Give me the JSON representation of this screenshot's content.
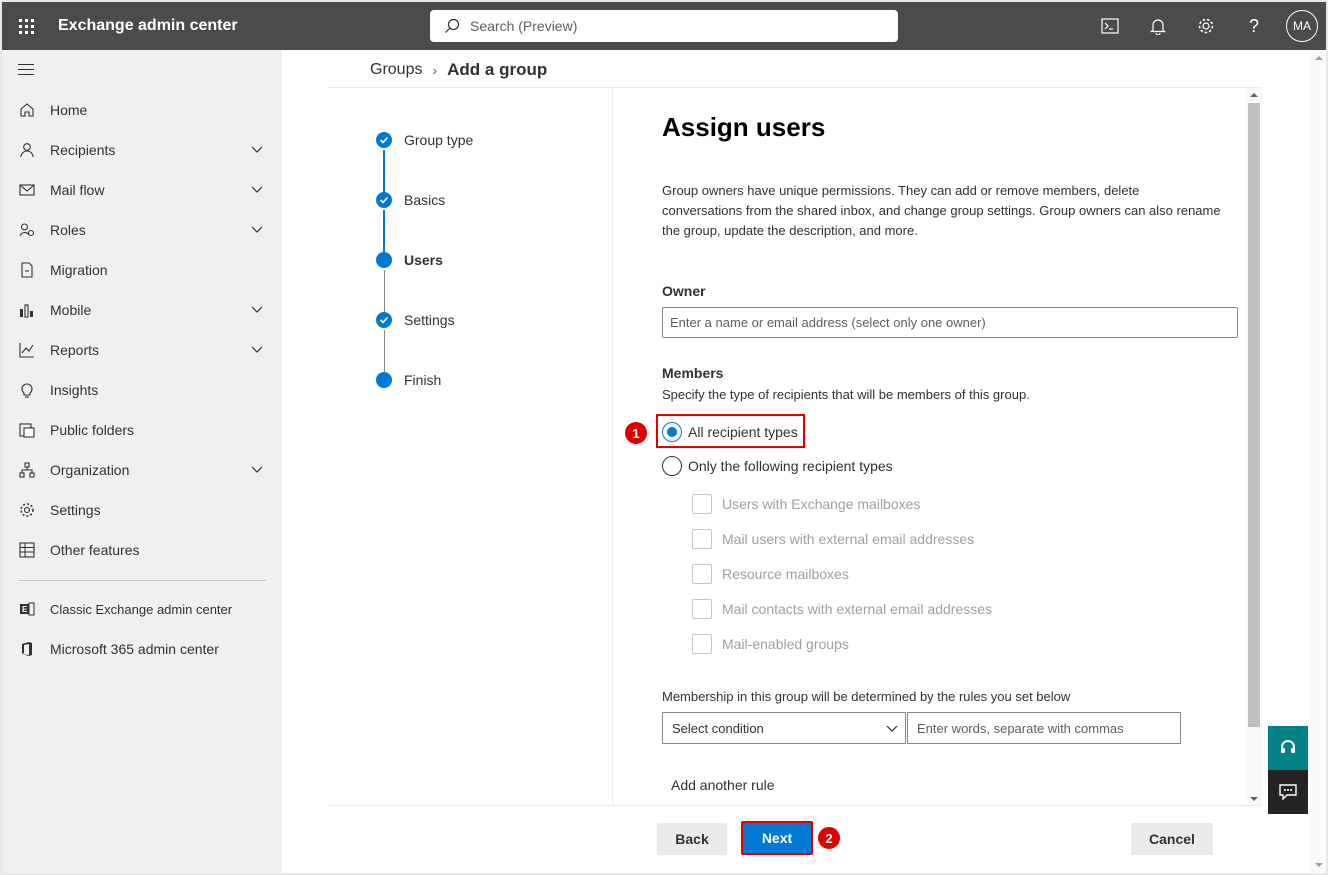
{
  "topbar": {
    "app_title": "Exchange admin center",
    "search_placeholder": "Search (Preview)",
    "avatar_initials": "MA",
    "icons": [
      "terminal-icon",
      "bell-icon",
      "gear-icon",
      "help-icon"
    ]
  },
  "sidebar": {
    "items": [
      {
        "label": "Home",
        "icon": "home-icon",
        "expandable": false
      },
      {
        "label": "Recipients",
        "icon": "person-icon",
        "expandable": true
      },
      {
        "label": "Mail flow",
        "icon": "mail-icon",
        "expandable": true
      },
      {
        "label": "Roles",
        "icon": "roles-icon",
        "expandable": true
      },
      {
        "label": "Migration",
        "icon": "migration-icon",
        "expandable": false
      },
      {
        "label": "Mobile",
        "icon": "mobile-icon",
        "expandable": true
      },
      {
        "label": "Reports",
        "icon": "chart-icon",
        "expandable": true
      },
      {
        "label": "Insights",
        "icon": "lightbulb-icon",
        "expandable": false
      },
      {
        "label": "Public folders",
        "icon": "folder-icon",
        "expandable": false
      },
      {
        "label": "Organization",
        "icon": "org-icon",
        "expandable": true
      },
      {
        "label": "Settings",
        "icon": "gear-icon",
        "expandable": false
      },
      {
        "label": "Other features",
        "icon": "grid-icon",
        "expandable": false
      }
    ],
    "links": [
      {
        "label": "Classic Exchange admin center",
        "icon": "exchange-icon"
      },
      {
        "label": "Microsoft 365 admin center",
        "icon": "office-icon"
      }
    ]
  },
  "breadcrumb": {
    "parent": "Groups",
    "current": "Add a group"
  },
  "wizard": {
    "steps": [
      {
        "label": "Group type",
        "state": "done"
      },
      {
        "label": "Basics",
        "state": "done"
      },
      {
        "label": "Users",
        "state": "current"
      },
      {
        "label": "Settings",
        "state": "done"
      },
      {
        "label": "Finish",
        "state": "pending"
      }
    ]
  },
  "form": {
    "heading": "Assign users",
    "description": "Group owners have unique permissions. They can add or remove members, delete conversations from the shared inbox, and change group settings. Group owners can also rename the group, update the description, and more.",
    "owner_label": "Owner",
    "owner_placeholder": "Enter a name or email address (select only one owner)",
    "members_label": "Members",
    "members_hint": "Specify the type of recipients that will be members of this group.",
    "radio_all": "All recipient types",
    "radio_only": "Only the following recipient types",
    "selected_radio": "all",
    "checkboxes": [
      "Users with Exchange mailboxes",
      "Mail users with external email addresses",
      "Resource mailboxes",
      "Mail contacts with external email addresses",
      "Mail-enabled groups"
    ],
    "rule_label": "Membership in this group will be determined by the rules you set below",
    "condition_placeholder": "Select condition",
    "words_placeholder": "Enter words, separate with commas",
    "add_rule": "Add another rule"
  },
  "annotations": {
    "badge1": "1",
    "badge2": "2"
  },
  "footer": {
    "back": "Back",
    "next": "Next",
    "cancel": "Cancel"
  },
  "colors": {
    "accent": "#0078d4",
    "highlight": "#e00000",
    "topbar": "#4b4b4b"
  }
}
